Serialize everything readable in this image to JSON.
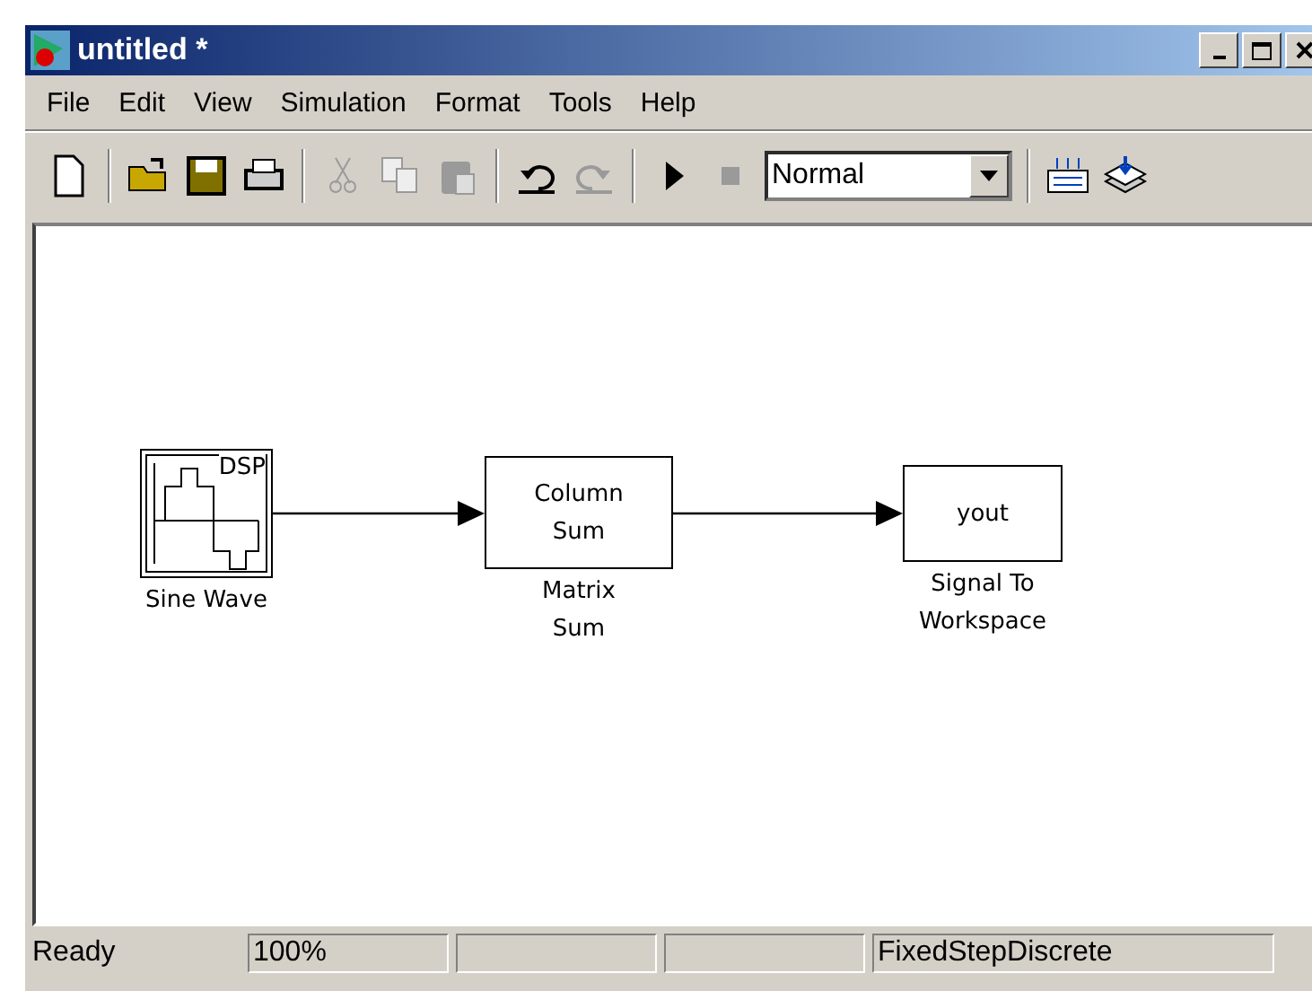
{
  "window": {
    "title": "untitled *"
  },
  "menu": [
    "File",
    "Edit",
    "View",
    "Simulation",
    "Format",
    "Tools",
    "Help"
  ],
  "toolbar": [
    {
      "kind": "new",
      "disabled": false
    },
    {
      "kind": "sep"
    },
    {
      "kind": "open",
      "disabled": false
    },
    {
      "kind": "save",
      "disabled": false
    },
    {
      "kind": "print",
      "disabled": false
    },
    {
      "kind": "sep"
    },
    {
      "kind": "cut",
      "disabled": true
    },
    {
      "kind": "copy",
      "disabled": true
    },
    {
      "kind": "paste",
      "disabled": true
    },
    {
      "kind": "sep"
    },
    {
      "kind": "undo",
      "disabled": false
    },
    {
      "kind": "redo",
      "disabled": true
    },
    {
      "kind": "sep"
    },
    {
      "kind": "play",
      "disabled": false
    },
    {
      "kind": "stop",
      "disabled": true
    },
    {
      "kind": "mode",
      "value": "Normal"
    },
    {
      "kind": "sep"
    },
    {
      "kind": "library",
      "disabled": false
    },
    {
      "kind": "layers",
      "disabled": false
    }
  ],
  "blocks": [
    {
      "kind": "sine",
      "badge": "DSP",
      "caption": [
        "Sine Wave"
      ]
    },
    {
      "kind": "text",
      "lines": [
        "Column",
        "Sum"
      ],
      "caption": [
        "Matrix",
        "Sum"
      ]
    },
    {
      "kind": "text",
      "lines": [
        "yout"
      ],
      "caption": [
        "Signal To",
        "Workspace"
      ]
    }
  ],
  "status_bar": [
    {
      "kind": "message",
      "text": "Ready"
    },
    {
      "kind": "field",
      "text": "100%"
    },
    {
      "kind": "empty"
    },
    {
      "kind": "empty"
    },
    {
      "kind": "field",
      "text": "FixedStepDiscrete"
    }
  ]
}
